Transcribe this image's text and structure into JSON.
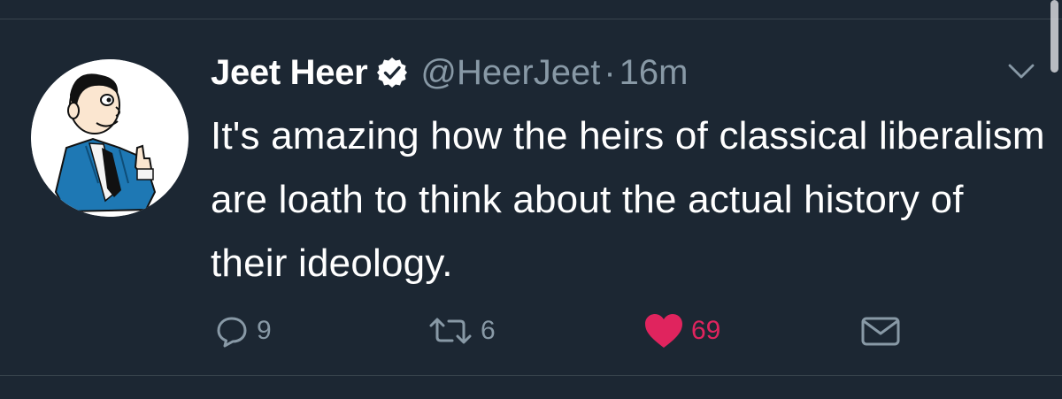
{
  "tweet": {
    "author_name": "Jeet Heer",
    "handle": "@HeerJeet",
    "separator": "·",
    "time": "16m",
    "verified": true,
    "text": "It's amazing how the heirs of classical liberalism are loath to think about the actual history of their ideology."
  },
  "actions": {
    "reply_count": "9",
    "retweet_count": "6",
    "like_count": "69"
  },
  "colors": {
    "background": "#1c2733",
    "text": "#ffffff",
    "secondary": "#8899a6",
    "like": "#e0245e",
    "divider": "#38444d"
  },
  "icons": {
    "verified": "verified-badge-icon",
    "caret": "chevron-down-icon",
    "reply": "reply-icon",
    "retweet": "retweet-icon",
    "like": "heart-icon",
    "message": "envelope-icon"
  }
}
